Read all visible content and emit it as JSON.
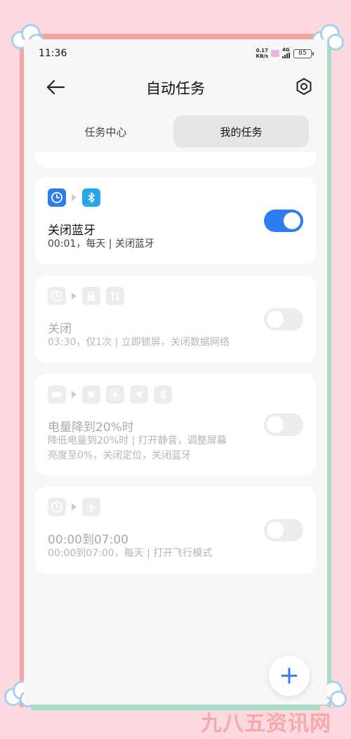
{
  "status_bar": {
    "time": "11:36",
    "speed_value": "0.17",
    "speed_unit": "KB/s",
    "network": "4G",
    "battery": "85"
  },
  "header": {
    "title": "自动任务",
    "back_icon": "arrow-left-icon",
    "settings_icon": "gear-icon"
  },
  "tabs": [
    {
      "label": "任务中心",
      "active": false
    },
    {
      "label": "我的任务",
      "active": true
    }
  ],
  "tasks": [
    {
      "title": "关闭蓝牙",
      "desc": "00:01，每天 | 关闭蓝牙",
      "enabled": true,
      "icons": [
        "clock-icon",
        "bluetooth-icon"
      ]
    },
    {
      "title": "关闭",
      "desc": "03:30，仅1次 | 立即锁屏，关闭数据网络",
      "enabled": false,
      "icons": [
        "clock-icon",
        "lock-icon",
        "data-network-icon"
      ]
    },
    {
      "title": "电量降到20%时",
      "desc_line1": "降低电量到20%时 | 打开静音，调整屏幕",
      "desc_line2": "亮度至0%，关闭定位，关闭蓝牙",
      "enabled": false,
      "icons": [
        "battery-icon",
        "mute-icon",
        "brightness-icon",
        "location-icon",
        "bluetooth-icon"
      ]
    },
    {
      "title": "00:00到07:00",
      "desc": "00:00到07:00，每天 | 打开飞行模式",
      "enabled": false,
      "icons": [
        "clock-icon",
        "airplane-icon"
      ]
    }
  ],
  "fab": {
    "icon": "plus-icon"
  },
  "watermark": "九八五资讯网",
  "colors": {
    "accent": "#2d7cf0",
    "frame_pink": "#f2a5a0",
    "frame_green": "#a8dcc4"
  }
}
